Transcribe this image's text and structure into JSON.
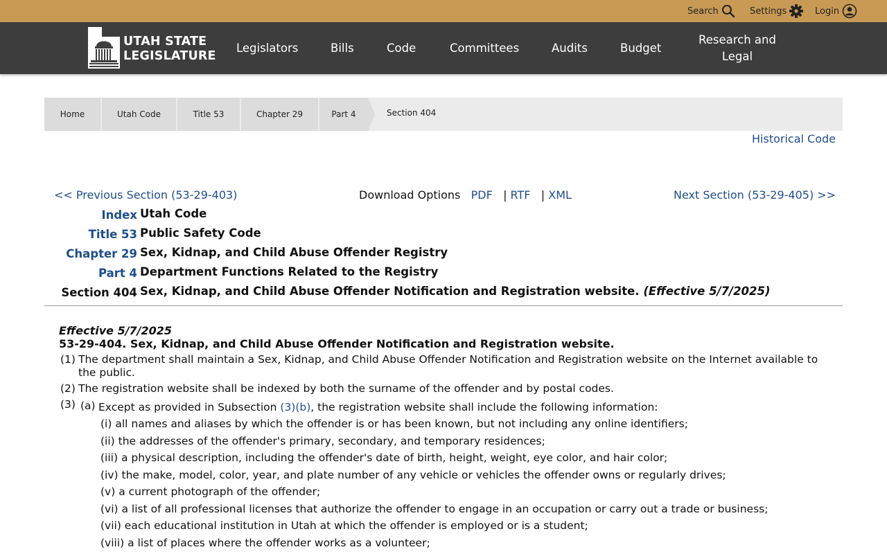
{
  "topbar": {
    "search_label": "Search",
    "settings_label": "Settings",
    "login_label": "Login"
  },
  "logo": {
    "line1": "UTAH STATE",
    "line2": "LEGISLATURE"
  },
  "nav": {
    "legislators": "Legislators",
    "bills": "Bills",
    "code": "Code",
    "committees": "Committees",
    "audits": "Audits",
    "budget": "Budget",
    "research_line1": "Research and",
    "research_line2": "Legal"
  },
  "breadcrumb": {
    "home": "Home",
    "utah_code": "Utah Code",
    "title": "Title 53",
    "chapter": "Chapter 29",
    "part": "Part 4",
    "current": "Section 404"
  },
  "historical_code": "Historical Code",
  "navigation": {
    "previous": "<< Previous Section (53-29-403)",
    "next": "Next Section (53-29-405) >>",
    "download_label": "Download Options",
    "pdf": "PDF",
    "rtf": "RTF",
    "xml": "XML",
    "sep": "|"
  },
  "hierarchy": {
    "index_label": "Index",
    "index_value": "Utah Code",
    "title_label": "Title 53",
    "title_value": "Public Safety Code",
    "chapter_label": "Chapter 29",
    "chapter_value": "Sex, Kidnap, and Child Abuse Offender Registry",
    "part_label": "Part 4",
    "part_value": "Department Functions Related to the Registry",
    "section_label": "Section 404",
    "section_value": "Sex, Kidnap, and Child Abuse Offender Notification and Registration website.",
    "section_effective": "(Effective 5/7/2025)"
  },
  "content": {
    "effective": "Effective 5/7/2025",
    "heading": "53-29-404.  Sex, Kidnap, and Child Abuse Offender Notification and Registration website.",
    "p1_num": "(1)",
    "p1_text": "The department shall maintain a Sex, Kidnap, and Child Abuse Offender Notification and Registration website on the Internet available to the public.",
    "p2_num": "(2)",
    "p2_text": "The registration website shall be indexed by both the surname of the offender and by postal codes.",
    "p3_num": "(3)",
    "p3a_num": "(a)",
    "p3a_text_before": "Except as provided in Subsection ",
    "p3a_link": "(3)(b)",
    "p3a_text_after": ", the registration website shall include the following information:",
    "items": [
      "(i) all names and aliases by which the offender is or has been known, but not including any online identifiers;",
      "(ii) the addresses of the offender's primary, secondary, and temporary residences;",
      "(iii) a physical description, including the offender's date of birth, height, weight, eye color, and hair color;",
      "(iv) the make, model, color, year, and plate number of any vehicle or vehicles the offender owns or regularly drives;",
      "(v) a current photograph of the offender;",
      "(vi) a list of all professional licenses that authorize the offender to engage in an occupation or carry out a trade or business;",
      "(vii) each educational institution in Utah at which the offender is employed or is a student;",
      "(viii) a list of places where the offender works as a volunteer;"
    ]
  },
  "colors": {
    "topbar": "#c99a55",
    "navbar": "#3d3d3d",
    "link": "#1f4e8c"
  }
}
